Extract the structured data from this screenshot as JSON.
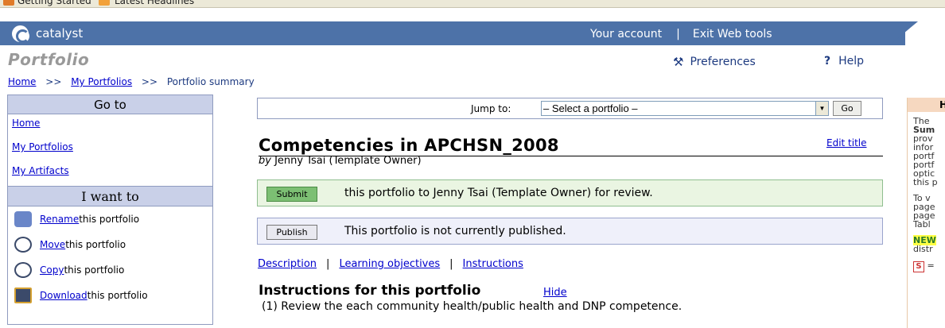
{
  "browser_bookmarks": [
    {
      "label": "Getting Started",
      "icon": "firefox-icon",
      "color": "#e07b2a"
    },
    {
      "label": "Latest Headlines",
      "icon": "rss-icon",
      "color": "#f2a13a"
    }
  ],
  "header": {
    "app_name": "catalyst",
    "your_account": "Your account",
    "separator": "|",
    "exit": "Exit Web tools",
    "bar_color": "#4d72a8"
  },
  "section_title": "Portfolio",
  "utility": {
    "preferences": "Preferences",
    "help_glyph": "?",
    "help": "Help"
  },
  "breadcrumb": {
    "home": "Home",
    "sep": ">>",
    "my_portfolios": "My Portfolios",
    "current": "Portfolio summary"
  },
  "sidebar": {
    "goto_title": "Go to",
    "goto_links": [
      "Home",
      "My Portfolios",
      "My Artifacts"
    ],
    "want_title": "I want to",
    "actions": [
      {
        "link": "Rename",
        "rest": " this portfolio",
        "icon": "rename-icon",
        "color": "#6a86c8"
      },
      {
        "link": "Move",
        "rest": " this portfolio",
        "icon": "move-icon",
        "color": "#3b4a6a"
      },
      {
        "link": "Copy",
        "rest": " this portfolio",
        "icon": "copy-icon",
        "color": "#3b4a6a"
      },
      {
        "link": "Download",
        "rest": " this portfolio",
        "icon": "download-icon",
        "color": "#d4a030"
      }
    ]
  },
  "jump": {
    "label": "Jump to:",
    "selected": "– Select a portfolio –",
    "go": "Go"
  },
  "portfolio": {
    "name": "Competencies in APCHSN_2008",
    "edit_title": "Edit title",
    "by_prefix": "by",
    "owner": "Jenny Tsai (Template Owner)"
  },
  "submit": {
    "button": "Submit",
    "text": "this portfolio to Jenny Tsai (Template Owner) for review."
  },
  "publish": {
    "button": "Publish",
    "text": "This portfolio is not currently published."
  },
  "tabs": {
    "description": "Description",
    "objectives": "Learning objectives",
    "instructions": "Instructions",
    "sep": "|"
  },
  "instructions": {
    "title": "Instructions for this portfolio",
    "hide": "Hide",
    "text": "(1) Review the each community health/public health and DNP competence."
  },
  "right_panel": {
    "head": "H",
    "lines": [
      "The",
      "Sum",
      "prov",
      "infor",
      "portf",
      "portf",
      "optic",
      "this p",
      "",
      "To v",
      "page",
      "page",
      "Tabl",
      "",
      "NEW",
      "distr"
    ],
    "icon_label": "S",
    "icon_suffix": "="
  }
}
